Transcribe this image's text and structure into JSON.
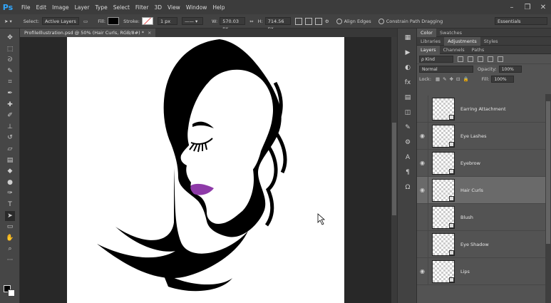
{
  "app": {
    "logo": "Ps",
    "menu": [
      "File",
      "Edit",
      "Image",
      "Layer",
      "Type",
      "Select",
      "Filter",
      "3D",
      "View",
      "Window",
      "Help"
    ],
    "window_controls": [
      "minimize-icon",
      "maximize-icon",
      "close-icon"
    ]
  },
  "options": {
    "select_label": "Select:",
    "select_value": "Active Layers",
    "fill_label": "Fill:",
    "fill_color": "#000000",
    "stroke_label": "Stroke:",
    "stroke_size": "1 px",
    "w_label": "W:",
    "w_value": "570.03 px",
    "h_label": "H:",
    "h_value": "714.56 px",
    "align_edges": "Align Edges",
    "constrain": "Constrain Path Dragging",
    "workspace": "Essentials"
  },
  "document": {
    "tab_title": "ProfileIllustration.psd @ 50% (Hair Curls, RGB/8#) *",
    "close": "×",
    "colors": {
      "hair": "#000000",
      "lips": "#8e3aa8",
      "canvas": "#ffffff"
    }
  },
  "tools": [
    "move-icon",
    "marquee-icon",
    "lasso-icon",
    "quick-select-icon",
    "crop-icon",
    "eyedropper-icon",
    "healing-icon",
    "brush-icon",
    "stamp-icon",
    "history-brush-icon",
    "eraser-icon",
    "gradient-icon",
    "blur-icon",
    "dodge-icon",
    "pen-icon",
    "type-icon",
    "path-select-icon",
    "shape-icon",
    "hand-icon",
    "zoom-icon",
    "more-icon"
  ],
  "panels": {
    "top_tabs": [
      "Color",
      "Swatches"
    ],
    "mid_tabs": [
      "Libraries",
      "Adjustments",
      "Styles"
    ],
    "layer_tabs": [
      "Layers",
      "Channels",
      "Paths"
    ],
    "filter_kind": "ρ Kind",
    "blend_mode": "Normal",
    "opacity_label": "Opacity:",
    "opacity_value": "100%",
    "lock_label": "Lock:",
    "fill_label": "Fill:",
    "fill_value": "100%"
  },
  "layers": [
    {
      "name": "Earring Attachment",
      "visible": false
    },
    {
      "name": "Eye Lashes",
      "visible": true
    },
    {
      "name": "Eyebrow",
      "visible": true
    },
    {
      "name": "Hair Curls",
      "visible": true,
      "selected": true
    },
    {
      "name": "Blush",
      "visible": false
    },
    {
      "name": "Eye Shadow",
      "visible": false
    },
    {
      "name": "Lips",
      "visible": true
    }
  ]
}
